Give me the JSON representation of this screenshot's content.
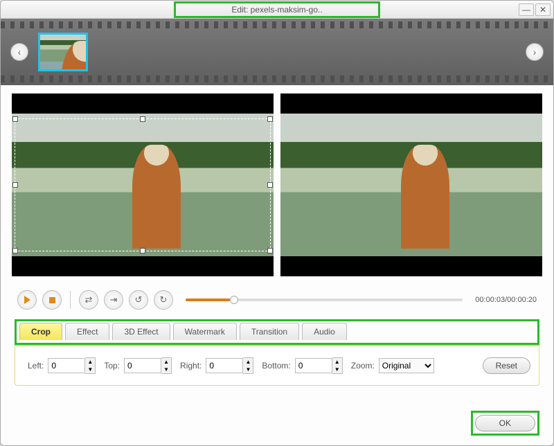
{
  "titlebar": {
    "title": "Edit: pexels-maksim-go.."
  },
  "playback": {
    "time": "00:00:03/00:00:20"
  },
  "tabs": [
    "Crop",
    "Effect",
    "3D Effect",
    "Watermark",
    "Transition",
    "Audio"
  ],
  "crop": {
    "left_label": "Left:",
    "left": "0",
    "top_label": "Top:",
    "top": "0",
    "right_label": "Right:",
    "right": "0",
    "bottom_label": "Bottom:",
    "bottom": "0",
    "zoom_label": "Zoom:",
    "zoom": "Original",
    "reset": "Reset"
  },
  "footer": {
    "ok": "OK"
  }
}
